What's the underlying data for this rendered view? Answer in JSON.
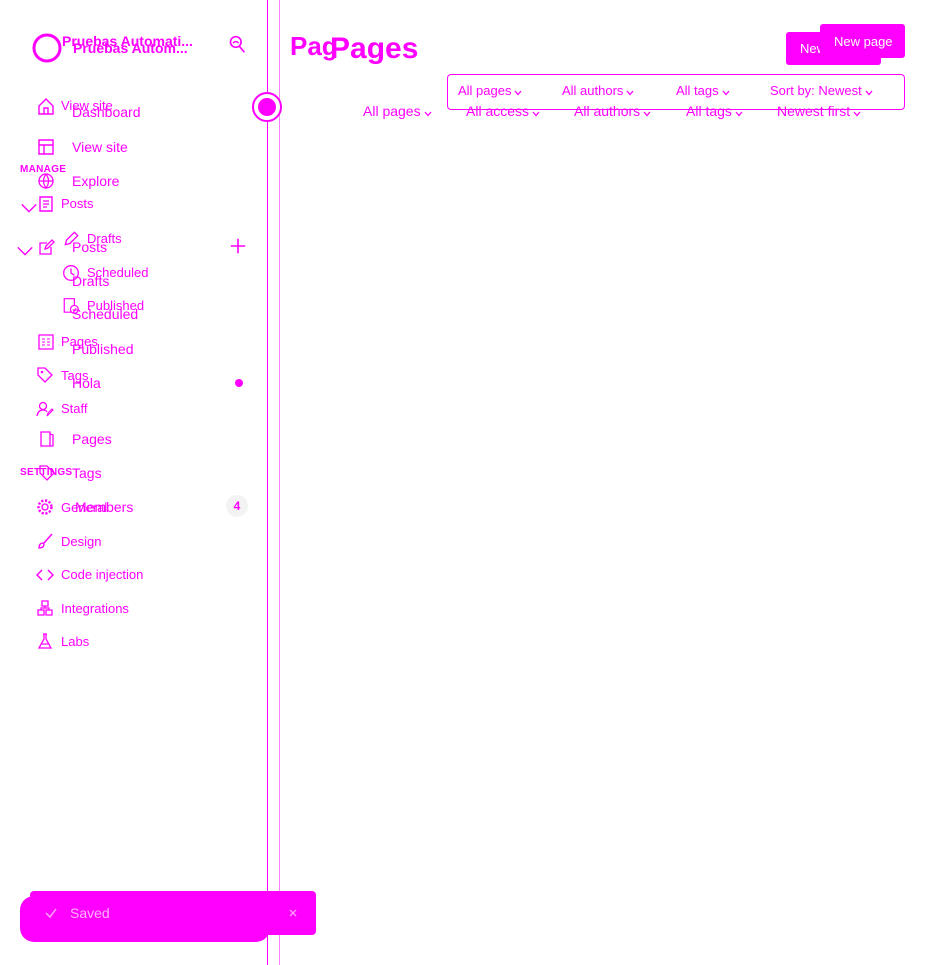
{
  "site": {
    "name_front": "Pruebas Automati...",
    "name_back": "Pruebas Autom..."
  },
  "nav_back": {
    "dashboard": "Dashboard",
    "view_site": "View site",
    "explore": "Explore",
    "posts": "Posts",
    "drafts": "Drafts",
    "scheduled": "Scheduled",
    "published": "Published",
    "hola": "Hola",
    "pages": "Pages",
    "tags": "Tags",
    "members": "Members",
    "members_count": "4"
  },
  "nav_front": {
    "view_site": "View site",
    "manage_label": "MANAGE",
    "posts": "Posts",
    "drafts": "Drafts",
    "scheduled": "Scheduled",
    "published": "Published",
    "pages": "Pages",
    "tags": "Tags",
    "staff": "Staff",
    "settings_label": "SETTINGS",
    "general": "General",
    "design": "Design",
    "code_injection": "Code injection",
    "integrations": "Integrations",
    "labs": "Labs"
  },
  "header": {
    "title_front": "Pages",
    "title_back": "Pag",
    "new_page_back": "New page",
    "new_page_front": "New page"
  },
  "filters_front": {
    "all_pages": "All pages",
    "all_authors": "All authors",
    "all_tags": "All tags",
    "sort": "Sort by: Newest"
  },
  "filters_back": {
    "all_pages": "All pages",
    "all_access": "All access",
    "all_authors": "All authors",
    "all_tags": "All tags",
    "newest_first": "Newest first"
  },
  "toast": {
    "message": "Saved"
  },
  "icons": [
    "ghost-logo-icon",
    "search-icon",
    "user-avatar-icon",
    "home-icon",
    "layout-icon",
    "globe-icon",
    "posts-icon",
    "edit-icon",
    "plus-icon",
    "pencil-icon",
    "clock-icon",
    "published-icon",
    "pages-icon",
    "page-icon",
    "tag-icon",
    "staff-icon",
    "gear-icon",
    "brush-icon",
    "code-icon",
    "integrations-icon",
    "labs-icon",
    "chevron-down-icon",
    "check-icon",
    "close-icon"
  ],
  "colors": {
    "accent": "#ff00ff",
    "background": "#ffffff",
    "badge_bg": "#f3f3f3"
  }
}
